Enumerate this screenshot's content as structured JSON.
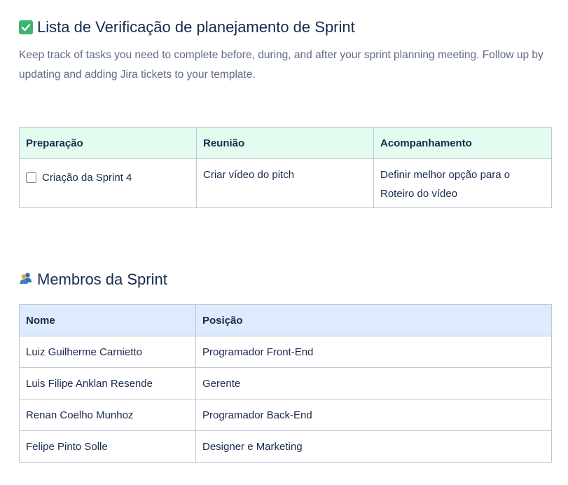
{
  "checklist": {
    "title": "Lista de Verificação de planejamento de Sprint",
    "title_icon": "check-mark-emoji",
    "description": "Keep track of tasks you need to complete before, during, and after your sprint planning meeting. Follow up by updating and adding Jira tickets to your template.",
    "columns": [
      "Preparação",
      "Reunião",
      "Acompanhamento"
    ],
    "row": {
      "preparacao": {
        "checked": false,
        "label": "Criação da Sprint 4"
      },
      "reuniao": "Criar vídeo do pitch",
      "acompanhamento": "Definir melhor opção para o Roteiro do vídeo"
    }
  },
  "members": {
    "title": "Membros da Sprint",
    "title_icon": "people-emoji",
    "columns": [
      "Nome",
      "Posição"
    ],
    "rows": [
      {
        "nome": "Luiz Guilherme Carnietto",
        "posicao": "Programador Front-End"
      },
      {
        "nome": "Luis Filipe Anklan Resende",
        "posicao": "Gerente"
      },
      {
        "nome": "Renan Coelho Munhoz",
        "posicao": "Programador Back-End"
      },
      {
        "nome": "Felipe Pinto Solle",
        "posicao": "Designer e Marketing"
      }
    ]
  },
  "colors": {
    "text": "#172b4d",
    "muted": "#5e6c84",
    "green_header": "#e3fcef",
    "blue_header": "#deebff",
    "border": "#c1c7d0"
  }
}
